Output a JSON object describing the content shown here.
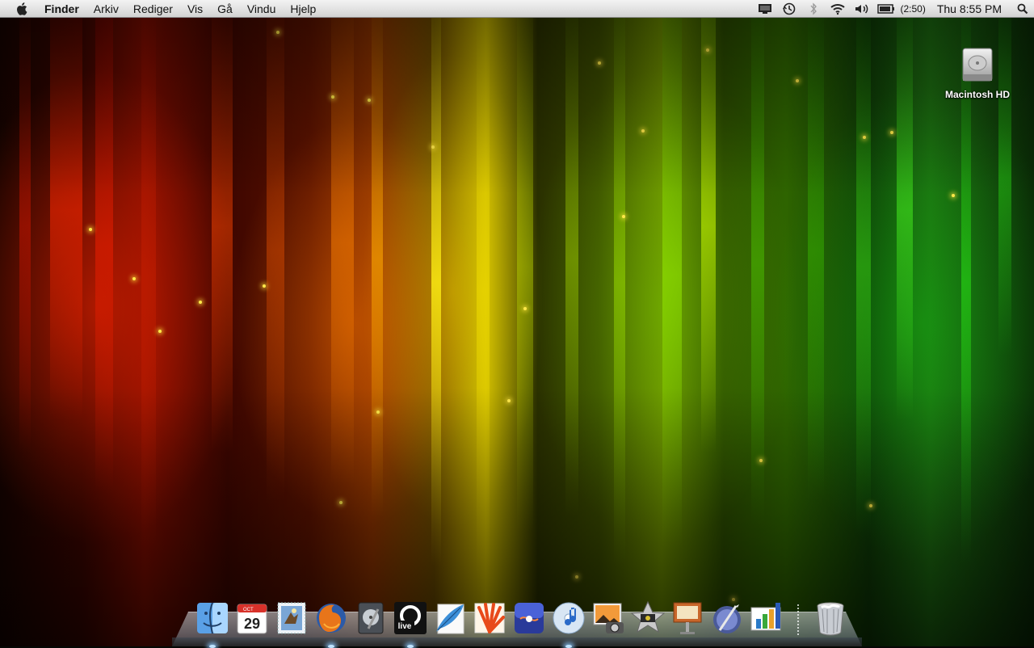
{
  "menubar": {
    "apple_icon": "apple-icon",
    "app_name": "Finder",
    "menus": [
      "Arkiv",
      "Rediger",
      "Vis",
      "Gå",
      "Vindu",
      "Hjelp"
    ],
    "status_icons": [
      "display-icon",
      "time-machine-icon",
      "bluetooth-icon",
      "wifi-icon",
      "volume-icon",
      "battery-icon"
    ],
    "battery_time": "(2:50)",
    "clock": "Thu 8:55 PM",
    "spotlight_icon": "spotlight-search-icon"
  },
  "desktop": {
    "icons": [
      {
        "label": "Macintosh HD",
        "icon": "hard-drive-icon"
      }
    ]
  },
  "dock": {
    "items": [
      {
        "name": "finder",
        "icon": "finder-icon",
        "running": true
      },
      {
        "name": "ical",
        "icon": "calendar-icon",
        "month": "OCT",
        "day": "29",
        "running": false
      },
      {
        "name": "mail",
        "icon": "mail-stamp-icon",
        "running": false
      },
      {
        "name": "firefox",
        "icon": "firefox-icon",
        "running": true
      },
      {
        "name": "disk-utility",
        "icon": "disk-utility-icon",
        "running": false
      },
      {
        "name": "ableton-live",
        "icon": "ableton-live-icon",
        "label": "live",
        "running": true
      },
      {
        "name": "feather-app",
        "icon": "feather-icon",
        "running": false
      },
      {
        "name": "illustrator-app",
        "icon": "flower-icon",
        "running": false
      },
      {
        "name": "ipod-app",
        "icon": "music-app-icon",
        "running": false
      },
      {
        "name": "itunes",
        "icon": "itunes-icon",
        "running": true
      },
      {
        "name": "iphoto",
        "icon": "iphoto-icon",
        "running": false
      },
      {
        "name": "imovie",
        "icon": "imovie-icon",
        "running": false
      },
      {
        "name": "keynote",
        "icon": "keynote-icon",
        "running": false
      },
      {
        "name": "pages",
        "icon": "pages-icon",
        "running": false
      },
      {
        "name": "numbers",
        "icon": "numbers-icon",
        "running": false
      }
    ],
    "trash": {
      "name": "trash",
      "icon": "trash-icon"
    }
  }
}
